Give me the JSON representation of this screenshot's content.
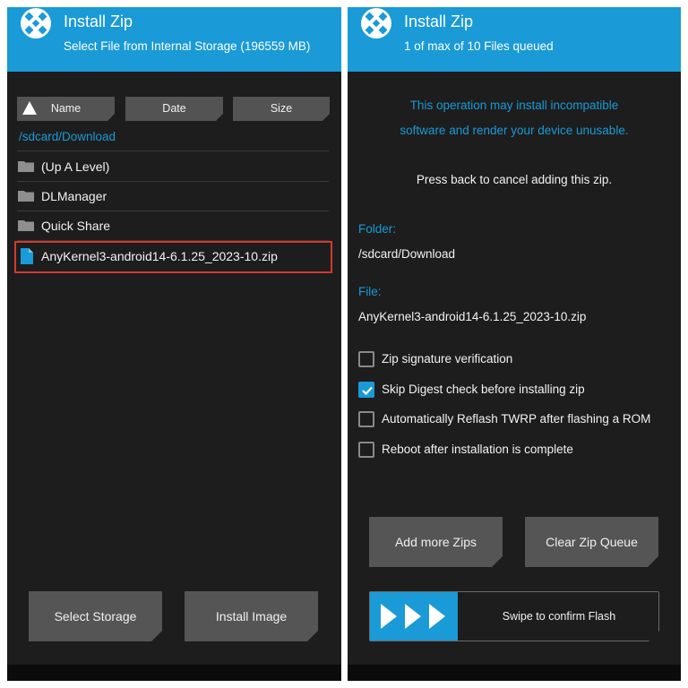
{
  "left": {
    "header": {
      "title": "Install Zip",
      "subtitle": "Select File from Internal Storage (196559 MB)"
    },
    "sort": {
      "name": "Name",
      "date": "Date",
      "size": "Size"
    },
    "path": "/sdcard/Download",
    "files": [
      {
        "label": "(Up A Level)",
        "type": "folder"
      },
      {
        "label": "DLManager",
        "type": "folder"
      },
      {
        "label": "Quick Share",
        "type": "folder"
      },
      {
        "label": "AnyKernel3-android14-6.1.25_2023-10.zip",
        "type": "file",
        "selected": true
      }
    ],
    "buttons": {
      "select_storage": "Select Storage",
      "install_image": "Install Image"
    }
  },
  "right": {
    "header": {
      "title": "Install Zip",
      "subtitle": "1 of max of 10 Files queued"
    },
    "warning_line1": "This operation may install incompatible",
    "warning_line2": "software and render your device unusable.",
    "cancel_info": "Press back to cancel adding this zip.",
    "folder_label": "Folder:",
    "folder_value": "/sdcard/Download",
    "file_label": "File:",
    "file_value": "AnyKernel3-android14-6.1.25_2023-10.zip",
    "options": [
      {
        "label": "Zip signature verification",
        "checked": false
      },
      {
        "label": "Skip Digest check before installing zip",
        "checked": true
      },
      {
        "label": "Automatically Reflash TWRP after flashing a ROM",
        "checked": false
      },
      {
        "label": "Reboot after installation is complete",
        "checked": false
      }
    ],
    "buttons": {
      "add_more": "Add more Zips",
      "clear_queue": "Clear Zip Queue"
    },
    "swipe_label": "Swipe to confirm Flash"
  },
  "colors": {
    "accent": "#1a9ad6",
    "panel_bg": "#1d1d1d",
    "button": "#555555",
    "highlight": "#d23a2f"
  },
  "icons": {
    "logo": "twrp-logo-icon",
    "folder": "folder-icon",
    "file": "zip-file-icon",
    "sort": "sort-triangle-icon",
    "swipe": "swipe-arrows-icon"
  }
}
